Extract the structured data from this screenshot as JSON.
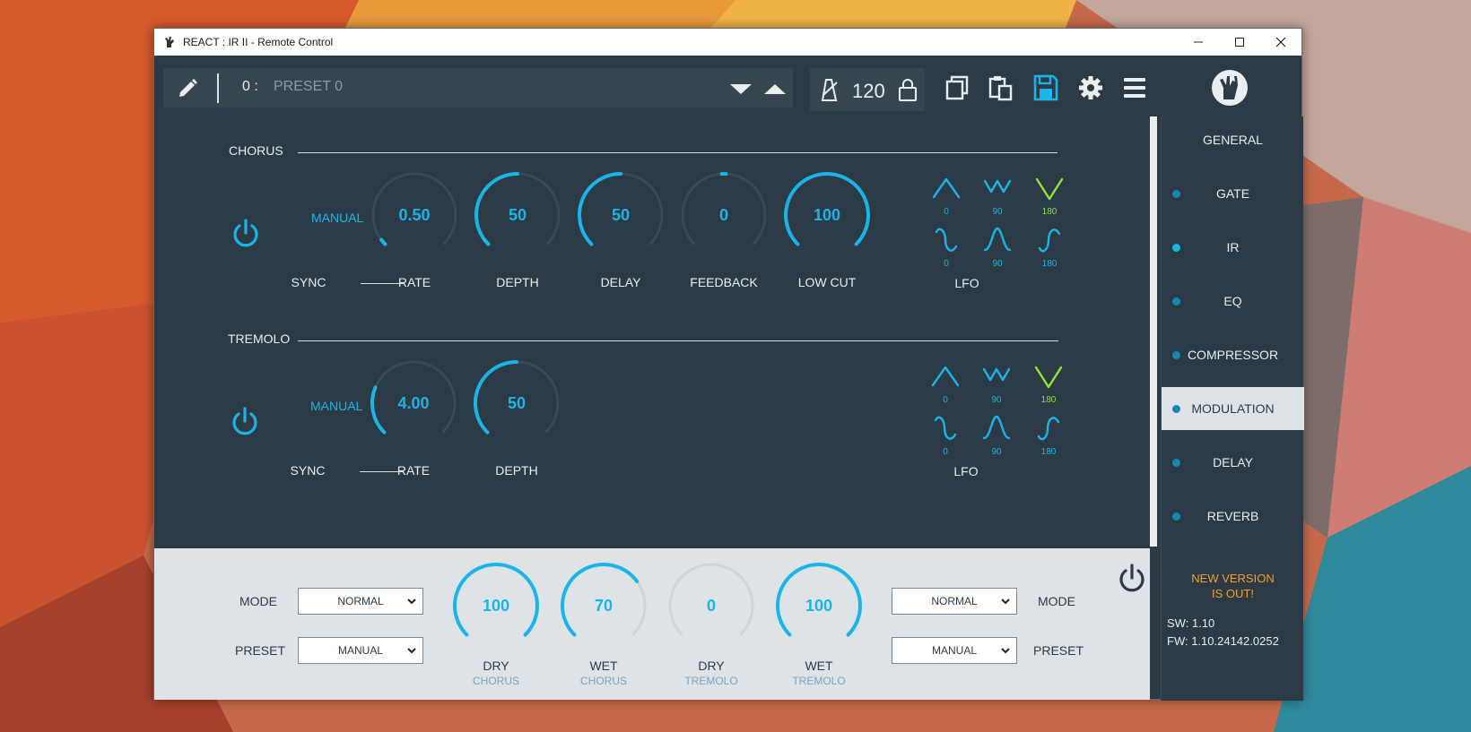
{
  "window": {
    "title": "REACT : IR II - Remote Control"
  },
  "toolbar": {
    "preset_number": "0 :",
    "preset_name": "PRESET 0",
    "tempo": "120"
  },
  "chorus": {
    "section_title": "CHORUS",
    "manual_label": "MANUAL",
    "sync_label": "SYNC",
    "knobs": [
      {
        "label": "RATE",
        "value": "0.50",
        "fraction": 0.03
      },
      {
        "label": "DEPTH",
        "value": "50",
        "fraction": 0.5
      },
      {
        "label": "DELAY",
        "value": "50",
        "fraction": 0.5
      },
      {
        "label": "FEEDBACK",
        "value": "0",
        "fraction": 0.5
      },
      {
        "label": "LOW CUT",
        "value": "100",
        "fraction": 1.0
      }
    ],
    "lfo_label": "LFO",
    "lfo_top": [
      "0",
      "90",
      "180"
    ],
    "lfo_bottom": [
      "0",
      "90",
      "180"
    ]
  },
  "tremolo": {
    "section_title": "TREMOLO",
    "manual_label": "MANUAL",
    "sync_label": "SYNC",
    "knobs": [
      {
        "label": "RATE",
        "value": "4.00",
        "fraction": 0.25
      },
      {
        "label": "DEPTH",
        "value": "50",
        "fraction": 0.5
      }
    ],
    "lfo_label": "LFO",
    "lfo_top": [
      "0",
      "90",
      "180"
    ],
    "lfo_bottom": [
      "0",
      "90",
      "180"
    ]
  },
  "footer": {
    "mode_label": "MODE",
    "preset_label": "PRESET",
    "left_mode": "NORMAL",
    "left_preset": "MANUAL",
    "right_mode": "NORMAL",
    "right_preset": "MANUAL",
    "knobs": [
      {
        "label": "DRY",
        "sub": "CHORUS",
        "value": "100",
        "fraction": 1.0
      },
      {
        "label": "WET",
        "sub": "CHORUS",
        "value": "70",
        "fraction": 0.7
      },
      {
        "label": "DRY",
        "sub": "TREMOLO",
        "value": "0",
        "fraction": 0.0
      },
      {
        "label": "WET",
        "sub": "TREMOLO",
        "value": "100",
        "fraction": 1.0
      }
    ]
  },
  "sidebar": {
    "items": [
      {
        "label": "GENERAL"
      },
      {
        "label": "GATE"
      },
      {
        "label": "IR"
      },
      {
        "label": "EQ"
      },
      {
        "label": "COMPRESSOR"
      },
      {
        "label": "MODULATION"
      },
      {
        "label": "DELAY"
      },
      {
        "label": "REVERB"
      }
    ],
    "new_version_line1": "NEW VERSION",
    "new_version_line2": "IS OUT!",
    "sw_version": "SW: 1.10",
    "fw_version": "FW: 1.10.24142.0252"
  },
  "colors": {
    "accent": "#1ab5e8",
    "panel": "#2c3a45",
    "footer": "#dde3e7",
    "lfo_selected": "#8fe43a",
    "new_version": "#f2a12c"
  },
  "icons": [
    "pencil-icon",
    "triangle-down-icon",
    "triangle-up-icon",
    "metronome-icon",
    "lock-icon",
    "copy-icon",
    "paste-icon",
    "save-icon",
    "gear-icon",
    "menu-icon",
    "rock-hand-logo-icon",
    "power-icon",
    "triangle-wave-icon",
    "inverted-triangle-wave-icon",
    "sine-wave-icon",
    "bell-wave-icon"
  ]
}
